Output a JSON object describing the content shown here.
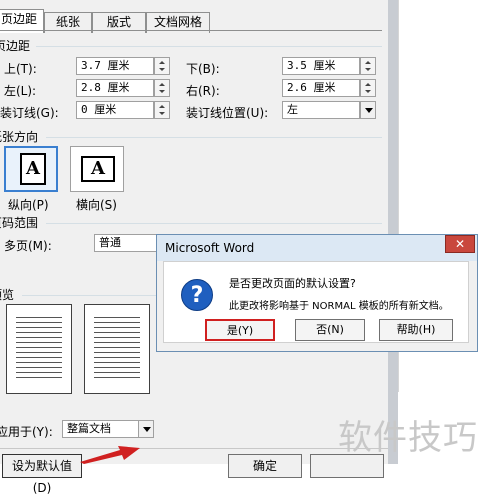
{
  "tabs": [
    {
      "label": "页边距",
      "active": true
    },
    {
      "label": "纸张",
      "active": false
    },
    {
      "label": "版式",
      "active": false
    },
    {
      "label": "文档网格",
      "active": false
    }
  ],
  "margins": {
    "section_title": "页边距",
    "top_label": "上(T):",
    "top_value": "3.7 厘米",
    "bottom_label": "下(B):",
    "bottom_value": "3.5 厘米",
    "left_label": "左(L):",
    "left_value": "2.8 厘米",
    "right_label": "右(R):",
    "right_value": "2.6 厘米",
    "gutter_label": "装订线(G):",
    "gutter_value": "0 厘米",
    "gutter_pos_label": "装订线位置(U):",
    "gutter_pos_value": "左"
  },
  "orientation": {
    "section_title": "纸张方向",
    "portrait_label": "纵向(P)",
    "landscape_label": "横向(S)",
    "icon_letter": "A"
  },
  "pages": {
    "section_title": "页码范围",
    "multiple_label": "多页(M):",
    "multiple_value": "普通"
  },
  "preview": {
    "section_title": "预览"
  },
  "apply": {
    "label": "应用于(Y):",
    "value": "整篇文档"
  },
  "bottom": {
    "default_button": "设为默认值(D)",
    "ok_button": "确定"
  },
  "messagebox": {
    "title": "Microsoft Word",
    "close_glyph": "✕",
    "question": "是否更改页面的默认设置?",
    "detail": "此更改将影响基于 NORMAL 模板的所有新文档。",
    "yes_button": "是(Y)",
    "no_button": "否(N)",
    "help_button": "帮助(H)"
  },
  "watermark": "软件技巧",
  "colors": {
    "highlight": "#d02020",
    "accent": "#1f5fbf"
  }
}
